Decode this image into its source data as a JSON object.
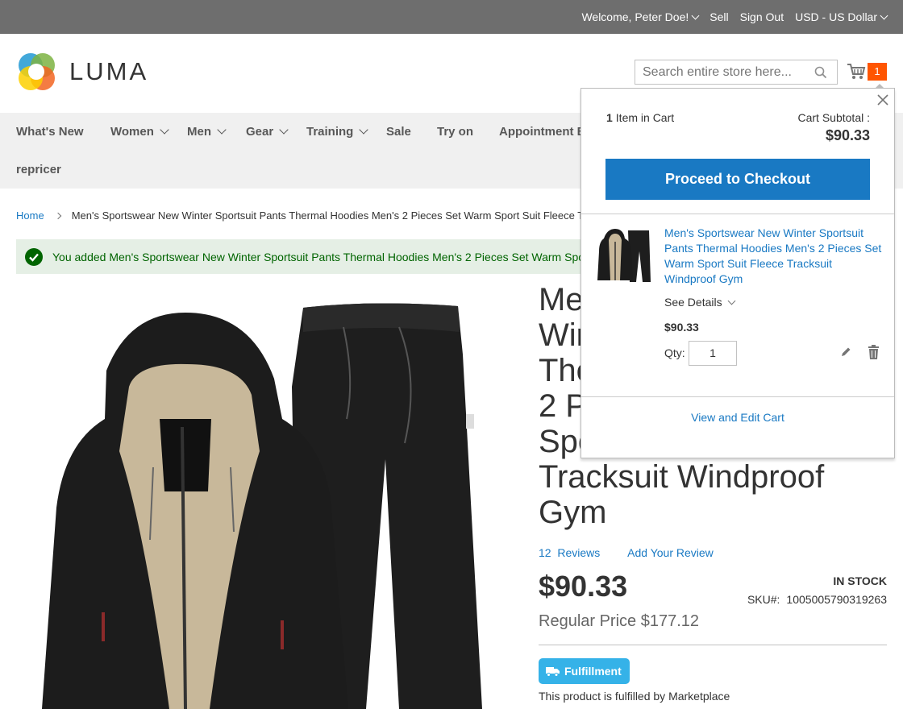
{
  "topbar": {
    "welcome": "Welcome, Peter Doe!",
    "sell": "Sell",
    "sign_out": "Sign Out",
    "currency": "USD - US Dollar"
  },
  "header": {
    "logo_text": "LUMA",
    "search_placeholder": "Search entire store here...",
    "cart_count": "1"
  },
  "nav": {
    "items": [
      {
        "label": "What's New",
        "dropdown": false
      },
      {
        "label": "Women",
        "dropdown": true
      },
      {
        "label": "Men",
        "dropdown": true
      },
      {
        "label": "Gear",
        "dropdown": true
      },
      {
        "label": "Training",
        "dropdown": true
      },
      {
        "label": "Sale",
        "dropdown": false
      },
      {
        "label": "Try on",
        "dropdown": false
      },
      {
        "label": "Appointment B",
        "dropdown": false
      },
      {
        "label": "repricer",
        "dropdown": false
      }
    ]
  },
  "breadcrumb": {
    "home": "Home",
    "current": "Men's Sportswear New Winter Sportsuit Pants Thermal Hoodies Men's 2 Pieces Set Warm Sport Suit Fleece Tracksuit Windproof Gym"
  },
  "message": {
    "text": "You added Men's Sportswear New Winter Sportsuit Pants Thermal Hoodies Men's 2 Pieces Set Warm Sport Suit Fleece Tracksuit Windproof Gym to your shopping cart."
  },
  "product": {
    "title_lines": [
      "Me",
      "Wir",
      "The",
      "2 P",
      "Spo",
      "Tracksuit Windproof",
      "Gym"
    ],
    "reviews_count": "12",
    "reviews_label": "Reviews",
    "add_review": "Add Your Review",
    "price": "$90.33",
    "stock": "IN STOCK",
    "sku_label": "SKU#:",
    "sku": "1005005790319263",
    "regular_price": "Regular Price $177.12",
    "fulfillment_badge": "Fulfillment",
    "fulfillment_note": "This product is fulfilled by Marketplace"
  },
  "minicart": {
    "items_count": "1",
    "items_label": "Item in Cart",
    "subtotal_label": "Cart Subtotal :",
    "subtotal": "$90.33",
    "checkout_label": "Proceed to Checkout",
    "item_name": "Men's Sportswear New Winter Sportsuit Pants Thermal Hoodies Men's 2 Pieces Set Warm Sport Suit Fleece Tracksuit Windproof Gym",
    "see_details": "See Details",
    "item_price": "$90.33",
    "qty_label": "Qty:",
    "qty_value": "1",
    "view_cart": "View and Edit Cart"
  },
  "colors": {
    "accent": "#1979c3",
    "cart_badge": "#ff5501",
    "topbar": "#6e6e6e",
    "success": "#006400",
    "fulfillment": "#35b2e8"
  }
}
